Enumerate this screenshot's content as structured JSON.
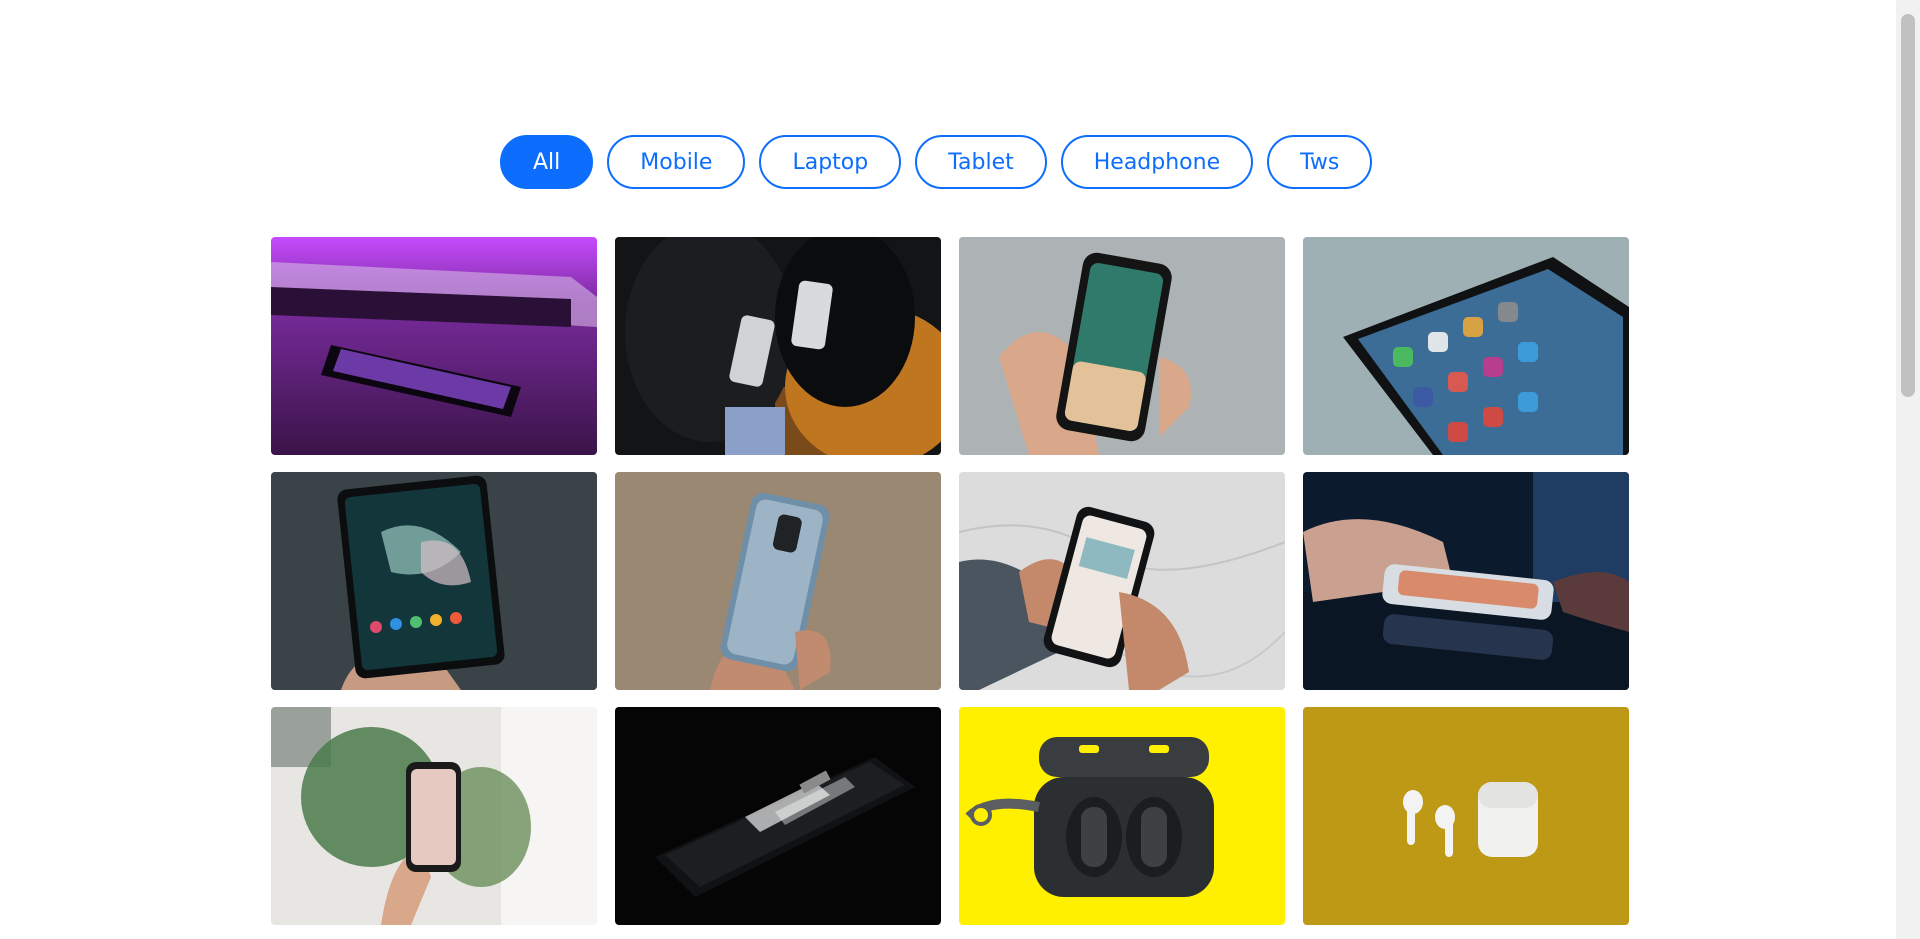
{
  "filters": {
    "items": [
      {
        "label": "All"
      },
      {
        "label": "Mobile"
      },
      {
        "label": "Laptop"
      },
      {
        "label": "Tablet"
      },
      {
        "label": "Headphone"
      },
      {
        "label": "Tws"
      }
    ],
    "active": "All",
    "accent_color": "#0d6efd"
  },
  "gallery": {
    "images": [
      {
        "subject": "phone on desk with purple light"
      },
      {
        "subject": "two people holding phones"
      },
      {
        "subject": "hand holding iPhone"
      },
      {
        "subject": "iPhone home screen closeup"
      },
      {
        "subject": "hand holding foldable phone"
      },
      {
        "subject": "hand holding OnePlus phone back"
      },
      {
        "subject": "hands using phone over marble"
      },
      {
        "subject": "hand tapping phone on glass table"
      },
      {
        "subject": "hand holding phone near plants"
      },
      {
        "subject": "glossy phone on dark surface"
      },
      {
        "subject": "earbuds case on yellow background"
      },
      {
        "subject": "AirPods on mustard background"
      }
    ]
  }
}
